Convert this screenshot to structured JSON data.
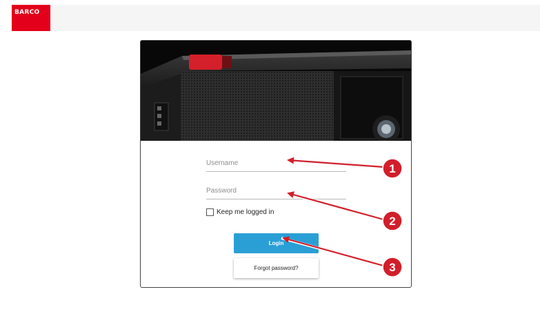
{
  "brand": {
    "logo_text": "BARCO",
    "color": "#e3001b"
  },
  "login_form": {
    "username_placeholder": "Username",
    "password_placeholder": "Password",
    "remember_label": "Keep me logged in",
    "login_label": "Login",
    "forgot_label": "Forgot password?",
    "accent_color": "#2a9fd6"
  },
  "callouts": [
    {
      "number": "1"
    },
    {
      "number": "2"
    },
    {
      "number": "3"
    }
  ]
}
